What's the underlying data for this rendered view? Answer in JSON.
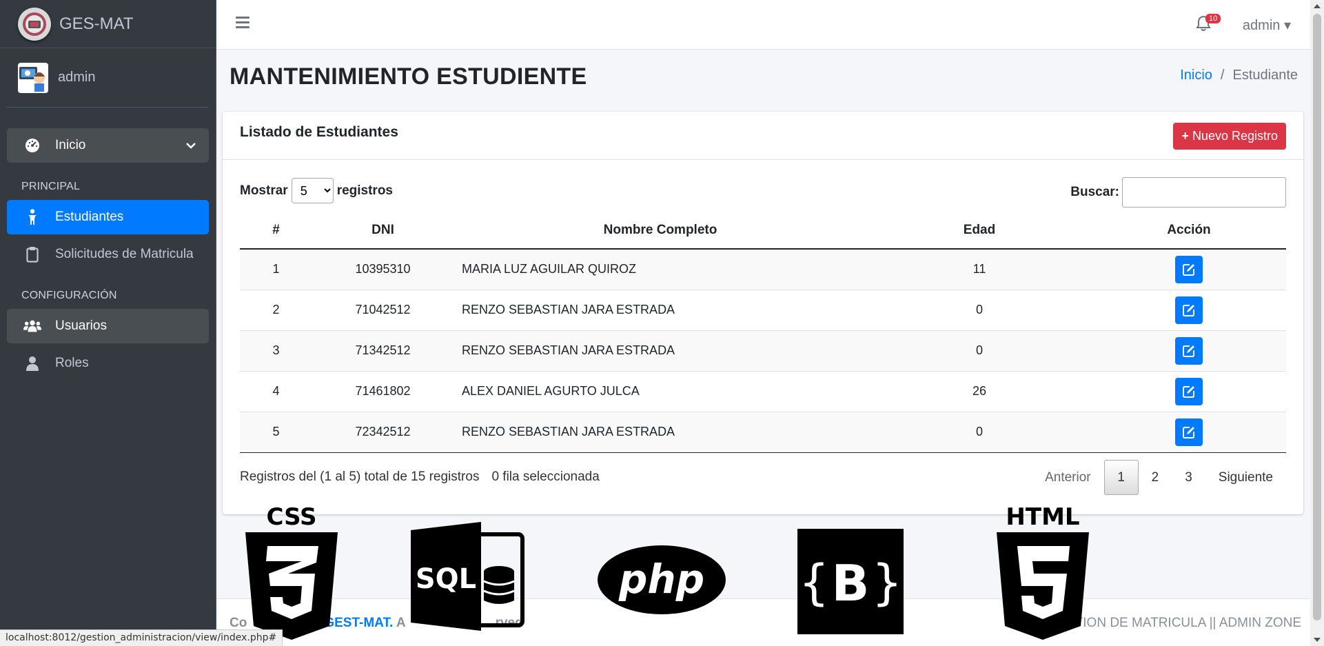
{
  "brand": {
    "name": "GES-MAT"
  },
  "user": {
    "name": "admin"
  },
  "sidebar": {
    "inicio_label": "Inicio",
    "principal_header": "PRINCIPAL",
    "config_header": "CONFIGURACIÓN",
    "items": [
      {
        "label": "Estudiantes",
        "icon": "child-icon"
      },
      {
        "label": "Solicitudes de Matricula",
        "icon": "clipboard-icon"
      },
      {
        "label": "Usuarios",
        "icon": "users-icon"
      },
      {
        "label": "Roles",
        "icon": "user-icon"
      }
    ]
  },
  "topbar": {
    "notifications": "10",
    "user_menu": "admin"
  },
  "page": {
    "title": "MANTENIMIENTO ESTUDIENTE"
  },
  "breadcrumb": {
    "home": "Inicio",
    "current": "Estudiante"
  },
  "card": {
    "title": "Listado de Estudiantes",
    "new_button": "Nuevo Registro",
    "show_prefix": "Mostrar",
    "show_value": "5",
    "show_suffix": "registros",
    "search_label": "Buscar:",
    "search_value": ""
  },
  "table": {
    "headers": [
      "#",
      "DNI",
      "Nombre Completo",
      "Edad",
      "Acción"
    ],
    "rows": [
      {
        "n": "1",
        "dni": "10395310",
        "name": "MARIA LUZ AGUILAR QUIROZ",
        "age": "11"
      },
      {
        "n": "2",
        "dni": "71042512",
        "name": "RENZO SEBASTIAN JARA ESTRADA",
        "age": "0"
      },
      {
        "n": "3",
        "dni": "71342512",
        "name": "RENZO SEBASTIAN JARA ESTRADA",
        "age": "0"
      },
      {
        "n": "4",
        "dni": "71461802",
        "name": "ALEX DANIEL AGURTO JULCA",
        "age": "26"
      },
      {
        "n": "5",
        "dni": "72342512",
        "name": "RENZO SEBASTIAN JARA ESTRADA",
        "age": "0"
      }
    ]
  },
  "info": {
    "records": "Registros del (1 al 5) total de 15 registros",
    "selected": "0 fila seleccionada"
  },
  "pagination": {
    "prev": "Anterior",
    "pages": [
      "1",
      "2",
      "3"
    ],
    "next": "Siguiente",
    "current": "1"
  },
  "footer": {
    "brand": "GEST-MAT.",
    "right": "GESTION DE MATRICULA || ADMIN ZONE"
  },
  "logos": {
    "css": "CSS",
    "sql": "SQL",
    "php": "php",
    "bootstrap": "B",
    "html": "HTML"
  },
  "status_url": "localhost:8012/gestion_administracion/view/index.php#",
  "colors": {
    "primary": "#007bff",
    "danger": "#dc3545",
    "sidebar": "#343a40"
  }
}
